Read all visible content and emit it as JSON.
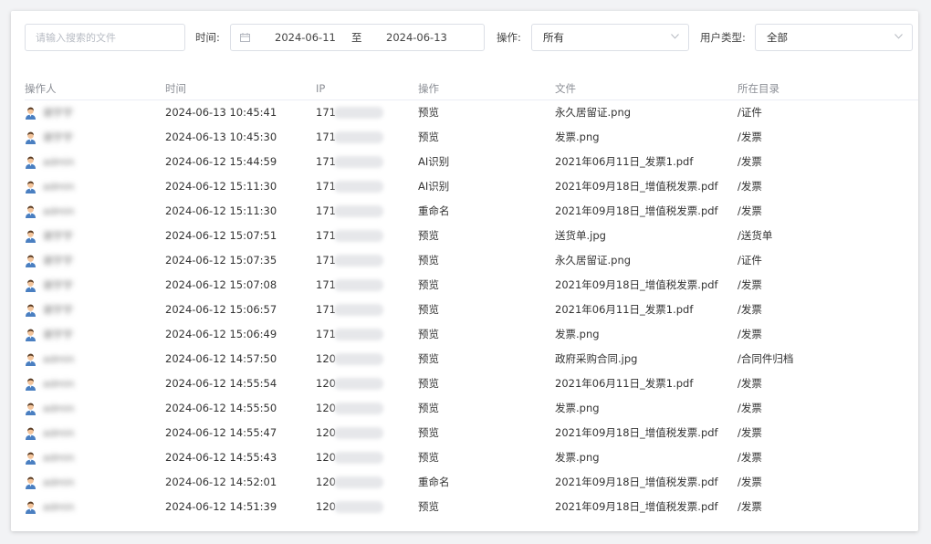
{
  "filters": {
    "search_placeholder": "请输入搜索的文件",
    "time_label": "时间:",
    "date_start": "2024-06-11",
    "date_sep": "至",
    "date_end": "2024-06-13",
    "op_label": "操作:",
    "op_value": "所有",
    "usertype_label": "用户类型:",
    "usertype_value": "全部"
  },
  "table": {
    "headers": [
      "操作人",
      "时间",
      "IP",
      "操作",
      "文件",
      "所在目录"
    ],
    "rows": [
      {
        "user": "谢宇宇",
        "time": "2024-06-13 10:45:41",
        "ip": "171",
        "op": "预览",
        "file": "永久居留证.png",
        "dir": "/证件"
      },
      {
        "user": "谢宇宇",
        "time": "2024-06-13 10:45:30",
        "ip": "171",
        "op": "预览",
        "file": "发票.png",
        "dir": "/发票"
      },
      {
        "user": "admin",
        "time": "2024-06-12 15:44:59",
        "ip": "171",
        "op": "AI识别",
        "file": "2021年06月11日_发票1.pdf",
        "dir": "/发票"
      },
      {
        "user": "admin",
        "time": "2024-06-12 15:11:30",
        "ip": "171",
        "op": "AI识别",
        "file": "2021年09月18日_增值税发票.pdf",
        "dir": "/发票"
      },
      {
        "user": "admin",
        "time": "2024-06-12 15:11:30",
        "ip": "171",
        "op": "重命名",
        "file": "2021年09月18日_增值税发票.pdf",
        "dir": "/发票"
      },
      {
        "user": "谢宇宇",
        "time": "2024-06-12 15:07:51",
        "ip": "171",
        "op": "预览",
        "file": "送货单.jpg",
        "dir": "/送货单"
      },
      {
        "user": "谢宇宇",
        "time": "2024-06-12 15:07:35",
        "ip": "171",
        "op": "预览",
        "file": "永久居留证.png",
        "dir": "/证件"
      },
      {
        "user": "谢宇宇",
        "time": "2024-06-12 15:07:08",
        "ip": "171",
        "op": "预览",
        "file": "2021年09月18日_增值税发票.pdf",
        "dir": "/发票"
      },
      {
        "user": "谢宇宇",
        "time": "2024-06-12 15:06:57",
        "ip": "171",
        "op": "预览",
        "file": "2021年06月11日_发票1.pdf",
        "dir": "/发票"
      },
      {
        "user": "谢宇宇",
        "time": "2024-06-12 15:06:49",
        "ip": "171",
        "op": "预览",
        "file": "发票.png",
        "dir": "/发票"
      },
      {
        "user": "admin",
        "time": "2024-06-12 14:57:50",
        "ip": "120",
        "op": "预览",
        "file": "政府采购合同.jpg",
        "dir": "/合同件归档"
      },
      {
        "user": "admin",
        "time": "2024-06-12 14:55:54",
        "ip": "120",
        "op": "预览",
        "file": "2021年06月11日_发票1.pdf",
        "dir": "/发票"
      },
      {
        "user": "admin",
        "time": "2024-06-12 14:55:50",
        "ip": "120",
        "op": "预览",
        "file": "发票.png",
        "dir": "/发票"
      },
      {
        "user": "admin",
        "time": "2024-06-12 14:55:47",
        "ip": "120",
        "op": "预览",
        "file": "2021年09月18日_增值税发票.pdf",
        "dir": "/发票"
      },
      {
        "user": "admin",
        "time": "2024-06-12 14:55:43",
        "ip": "120",
        "op": "预览",
        "file": "发票.png",
        "dir": "/发票"
      },
      {
        "user": "admin",
        "time": "2024-06-12 14:52:01",
        "ip": "120",
        "op": "重命名",
        "file": "2021年09月18日_增值税发票.pdf",
        "dir": "/发票"
      },
      {
        "user": "admin",
        "time": "2024-06-12 14:51:39",
        "ip": "120",
        "op": "预览",
        "file": "2021年09月18日_增值税发票.pdf",
        "dir": "/发票"
      }
    ]
  },
  "icons": {
    "avatar": "user-avatar-icon",
    "calendar": "calendar-icon",
    "dropdown": "chevron-down-icon"
  },
  "colors": {
    "border": "#dcdfe6",
    "header_text": "#8c8f96",
    "avatar_skin": "#f3c49b",
    "avatar_shirt": "#4a7fc1"
  }
}
